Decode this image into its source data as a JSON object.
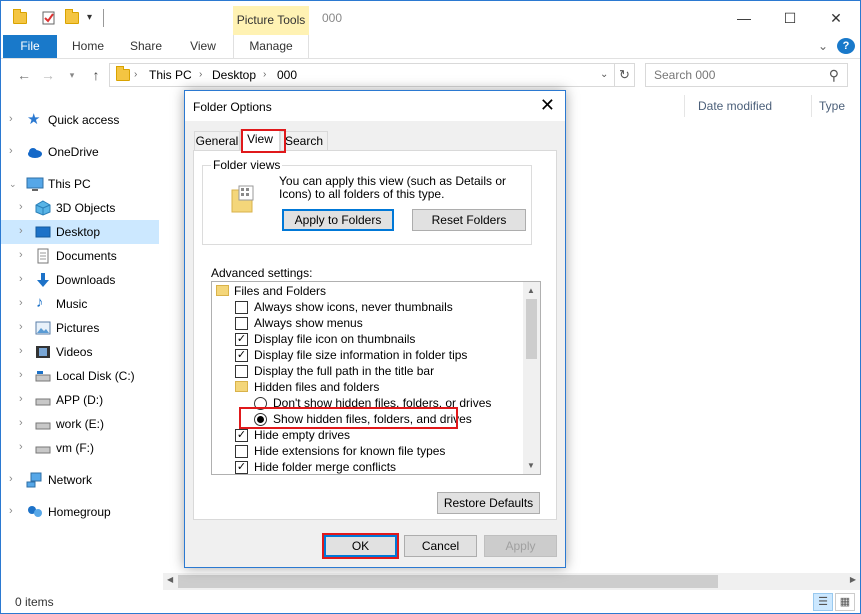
{
  "window": {
    "title": "000",
    "picture_tools": "Picture Tools",
    "minimize": "—",
    "maximize": "☐",
    "close": "✕"
  },
  "ribbon": {
    "tabs": [
      "File",
      "Home",
      "Share",
      "View",
      "Manage"
    ],
    "collapse": "⌄",
    "help": "?"
  },
  "address": {
    "breadcrumbs": [
      "This PC",
      "Desktop",
      "000"
    ],
    "search_placeholder": "Search 000"
  },
  "nav": {
    "items": [
      {
        "label": "Quick access",
        "icon": "star-icon"
      },
      {
        "label": "OneDrive",
        "icon": "cloud-icon"
      },
      {
        "label": "This PC",
        "icon": "computer-icon"
      },
      {
        "label": "3D Objects",
        "icon": "cube-icon"
      },
      {
        "label": "Desktop",
        "icon": "desktop-icon"
      },
      {
        "label": "Documents",
        "icon": "document-icon"
      },
      {
        "label": "Downloads",
        "icon": "download-icon"
      },
      {
        "label": "Music",
        "icon": "music-icon"
      },
      {
        "label": "Pictures",
        "icon": "pictures-icon"
      },
      {
        "label": "Videos",
        "icon": "videos-icon"
      },
      {
        "label": "Local Disk (C:)",
        "icon": "drive-icon"
      },
      {
        "label": "APP (D:)",
        "icon": "drive-icon"
      },
      {
        "label": "work (E:)",
        "icon": "drive-icon"
      },
      {
        "label": "vm (F:)",
        "icon": "drive-icon"
      },
      {
        "label": "Network",
        "icon": "network-icon"
      },
      {
        "label": "Homegroup",
        "icon": "homegroup-icon"
      }
    ]
  },
  "columns": {
    "date_modified": "Date modified",
    "type": "Type"
  },
  "status": {
    "items": "0 items"
  },
  "dialog": {
    "title": "Folder Options",
    "tabs": [
      "General",
      "View",
      "Search"
    ],
    "folder_views_label": "Folder views",
    "folder_views_text": "You can apply this view (such as Details or Icons) to all folders of this type.",
    "apply_to_folders": "Apply to Folders",
    "reset_folders": "Reset Folders",
    "advanced_label": "Advanced settings:",
    "settings": [
      {
        "type": "folder",
        "label": "Files and Folders"
      },
      {
        "type": "checkbox",
        "checked": false,
        "label": "Always show icons, never thumbnails"
      },
      {
        "type": "checkbox",
        "checked": false,
        "label": "Always show menus"
      },
      {
        "type": "checkbox",
        "checked": true,
        "label": "Display file icon on thumbnails"
      },
      {
        "type": "checkbox",
        "checked": true,
        "label": "Display file size information in folder tips"
      },
      {
        "type": "checkbox",
        "checked": false,
        "label": "Display the full path in the title bar"
      },
      {
        "type": "folder",
        "label": "Hidden files and folders"
      },
      {
        "type": "radio",
        "checked": false,
        "label": "Don't show hidden files, folders, or drives"
      },
      {
        "type": "radio",
        "checked": true,
        "label": "Show hidden files, folders, and drives"
      },
      {
        "type": "checkbox",
        "checked": true,
        "label": "Hide empty drives"
      },
      {
        "type": "checkbox",
        "checked": false,
        "label": "Hide extensions for known file types"
      },
      {
        "type": "checkbox",
        "checked": true,
        "label": "Hide folder merge conflicts"
      }
    ],
    "restore_defaults": "Restore Defaults",
    "ok": "OK",
    "cancel": "Cancel",
    "apply": "Apply"
  },
  "colors": {
    "accent": "#1979ca",
    "selection": "#cce8ff",
    "highlight": "#e0191b",
    "picture_tools_bg": "#fff2b3"
  }
}
